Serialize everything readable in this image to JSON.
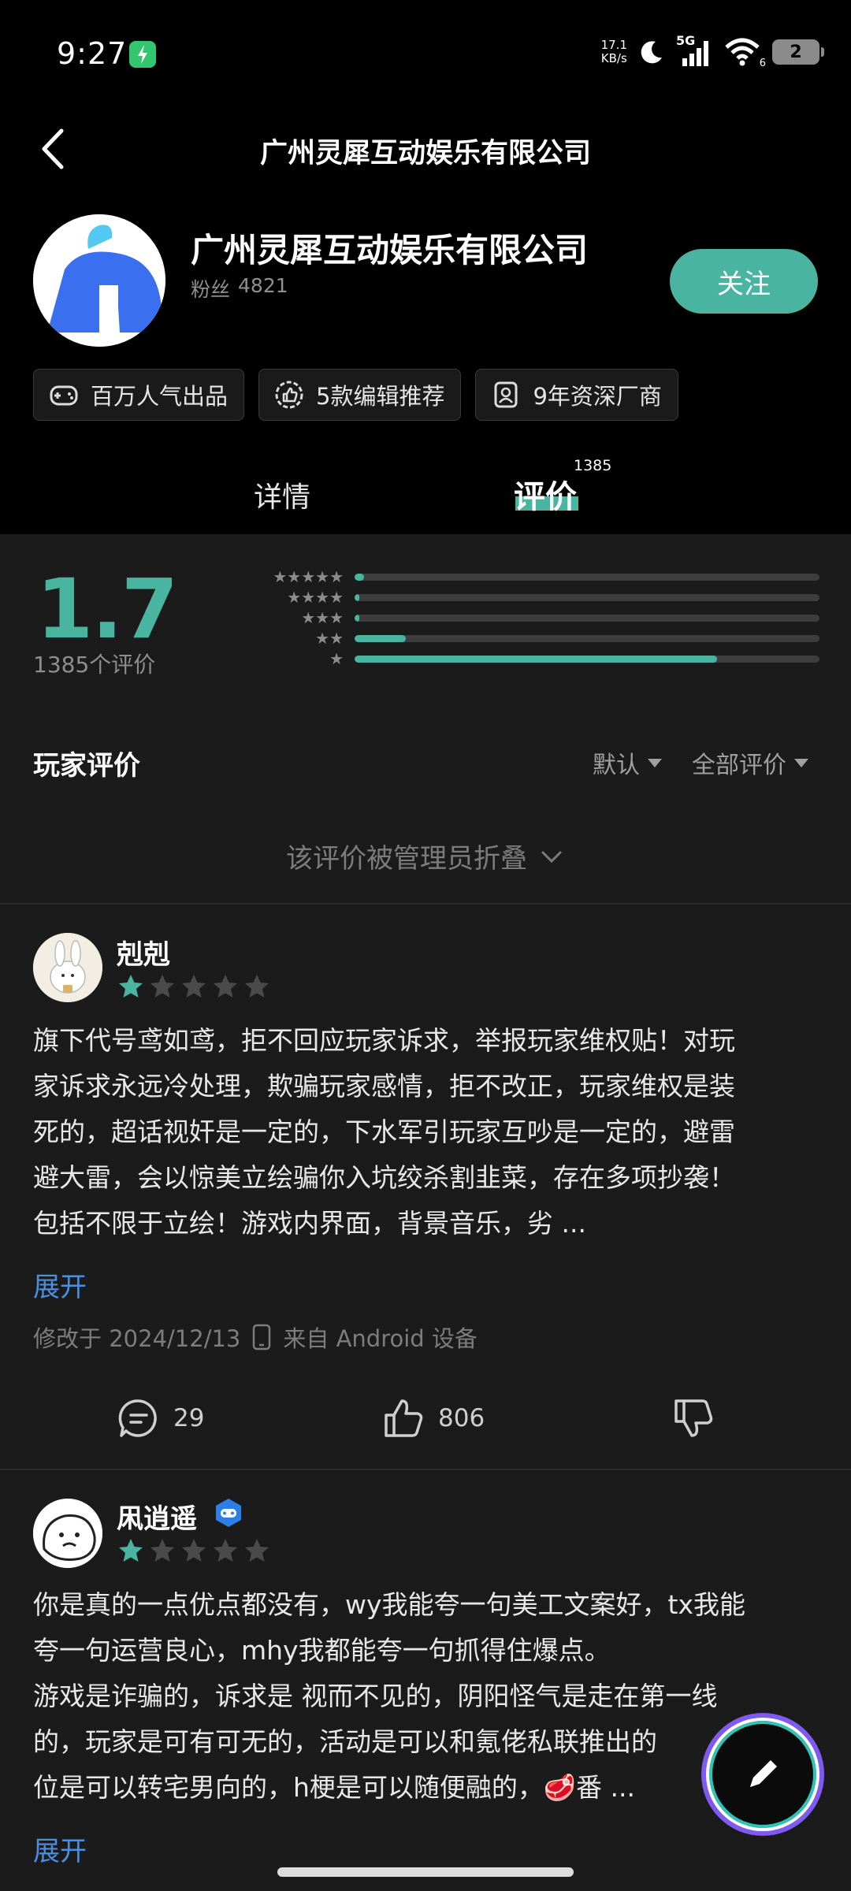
{
  "status_bar": {
    "time": "9:27",
    "net_speed_value": "17.1",
    "net_speed_unit": "KB/s",
    "network": "5G",
    "wifi_level": "6",
    "battery": "2"
  },
  "header": {
    "title": "广州灵犀互动娱乐有限公司"
  },
  "company": {
    "name": "广州灵犀互动娱乐有限公司",
    "fans_label": "粉丝",
    "fans_count": "4821",
    "follow_label": "关注"
  },
  "tags": [
    {
      "label": "百万人气出品",
      "icon": "gamepad-icon"
    },
    {
      "label": "5款编辑推荐",
      "icon": "thumbs-up-badge-icon"
    },
    {
      "label": "9年资深厂商",
      "icon": "id-badge-icon"
    }
  ],
  "tabs": {
    "detail": "详情",
    "review": "评价",
    "review_count": "1385"
  },
  "rating": {
    "score": "1.7",
    "count_label": "1385个评价",
    "distribution": [
      {
        "stars": 5,
        "fraction": 0.02
      },
      {
        "stars": 4,
        "fraction": 0.01
      },
      {
        "stars": 3,
        "fraction": 0.01
      },
      {
        "stars": 2,
        "fraction": 0.11
      },
      {
        "stars": 1,
        "fraction": 0.78
      }
    ]
  },
  "reviews_section": {
    "title": "玩家评价",
    "sort_default": "默认",
    "filter_all": "全部评价",
    "folded_notice": "该评价被管理员折叠"
  },
  "reviews": [
    {
      "user": "剋剋",
      "rating": 1,
      "lines": [
        "旗下代号鸢如鸢，拒不回应玩家诉求，举报玩家维权贴！对玩",
        "家诉求永远冷处理，欺骗玩家感情，拒不改正，玩家维权是装",
        "死的，超话视奸是一定的，下水军引玩家互吵是一定的，避雷",
        "避大雷，会以惊美立绘骗你入坑绞杀割韭菜，存在多项抄袭！",
        "包括不限于立绘！游戏内界面，背景音乐，劣 ..."
      ],
      "expand_label": "展开",
      "modified": "修改于 2024/12/13",
      "device": "来自 Android 设备",
      "comments": "29",
      "likes": "806"
    },
    {
      "user": "凩逍遥",
      "rating": 1,
      "lines": [
        "你是真的一点优点都没有，wy我能夸一句美工文案好，tx我能",
        "夸一句运营良心，mhy我都能夸一句抓得住爆点。",
        "游戏是诈骗的，诉求是 视而不见的，阴阳怪气是走在第一线",
        "的，玩家是可有可无的，活动是可以和氪佬私联推出的",
        "位是可以转宅男向的，h梗是可以随便融的，🥩番 ..."
      ],
      "expand_label": "展开"
    }
  ]
}
